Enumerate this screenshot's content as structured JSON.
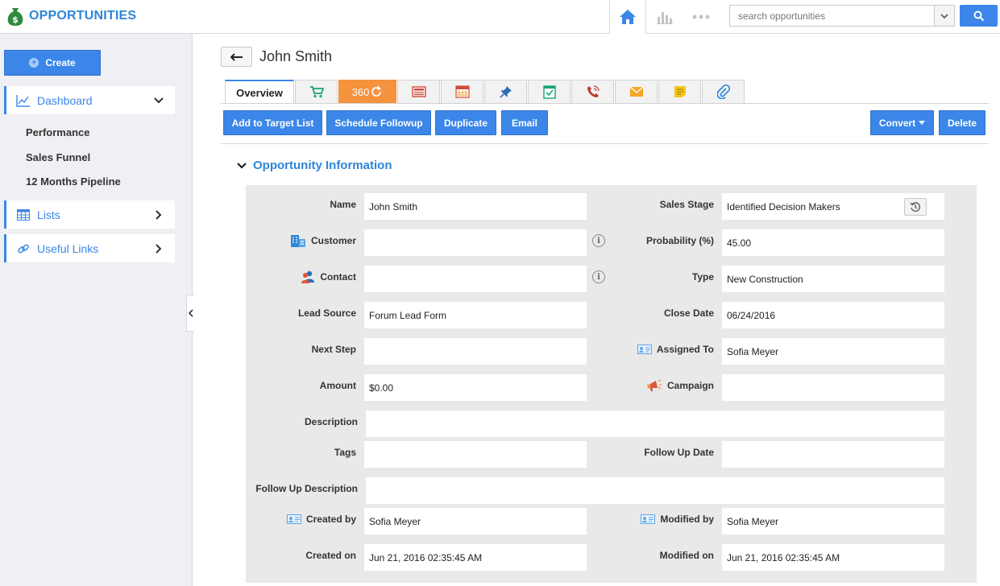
{
  "app": {
    "title": "OPPORTUNITIES"
  },
  "search": {
    "placeholder": "search opportunities",
    "button_icon": "search-icon"
  },
  "topnav": {
    "items": [
      "home-icon",
      "chart-icon",
      "more-dots-icon"
    ]
  },
  "sidebar": {
    "create_label": "Create",
    "items": [
      {
        "label": "Dashboard",
        "icon": "line-chart-icon"
      },
      {
        "label": "Lists",
        "icon": "table-icon"
      },
      {
        "label": "Useful Links",
        "icon": "link-icon"
      }
    ],
    "dashboard_sub": [
      "Performance",
      "Sales Funnel",
      "12 Months Pipeline"
    ]
  },
  "record": {
    "title": "John Smith"
  },
  "tabs": {
    "overview": "Overview",
    "t360": "360",
    "icons": [
      "cart-icon",
      "360-icon",
      "newspaper-icon",
      "calendar-icon",
      "pin-icon",
      "checklist-icon",
      "phone-icon",
      "mail-icon",
      "note-icon",
      "paperclip-icon"
    ]
  },
  "actions": {
    "add_to_target_list": "Add to Target List",
    "schedule_followup": "Schedule Followup",
    "duplicate": "Duplicate",
    "email": "Email",
    "convert": "Convert",
    "delete": "Delete"
  },
  "section": {
    "title": "Opportunity Information"
  },
  "fields": {
    "name": {
      "label": "Name",
      "value": "John Smith"
    },
    "sales_stage": {
      "label": "Sales Stage",
      "value": "Identified Decision Makers"
    },
    "customer": {
      "label": "Customer",
      "value": ""
    },
    "probability": {
      "label": "Probability (%)",
      "value": "45.00"
    },
    "contact": {
      "label": "Contact",
      "value": ""
    },
    "type": {
      "label": "Type",
      "value": "New Construction"
    },
    "lead_source": {
      "label": "Lead Source",
      "value": "Forum Lead Form"
    },
    "close_date": {
      "label": "Close Date",
      "value": "06/24/2016"
    },
    "next_step": {
      "label": "Next Step",
      "value": ""
    },
    "assigned_to": {
      "label": "Assigned To",
      "value": "Sofia Meyer"
    },
    "amount": {
      "label": "Amount",
      "value": "$0.00"
    },
    "campaign": {
      "label": "Campaign",
      "value": ""
    },
    "description": {
      "label": "Description",
      "value": ""
    },
    "tags": {
      "label": "Tags",
      "value": ""
    },
    "follow_up_date": {
      "label": "Follow Up Date",
      "value": ""
    },
    "follow_up_description": {
      "label": "Follow Up Description",
      "value": ""
    },
    "created_by": {
      "label": "Created by",
      "value": "Sofia Meyer"
    },
    "modified_by": {
      "label": "Modified by",
      "value": "Sofia Meyer"
    },
    "created_on": {
      "label": "Created on",
      "value": "Jun 21, 2016 02:35:45 AM"
    },
    "modified_on": {
      "label": "Modified on",
      "value": "Jun 21, 2016 02:35:45 AM"
    }
  },
  "colors": {
    "accent": "#3b86e8",
    "brand": "#2d86d8",
    "tab360": "#f5923e",
    "money_bag": "#2e8b3e"
  }
}
